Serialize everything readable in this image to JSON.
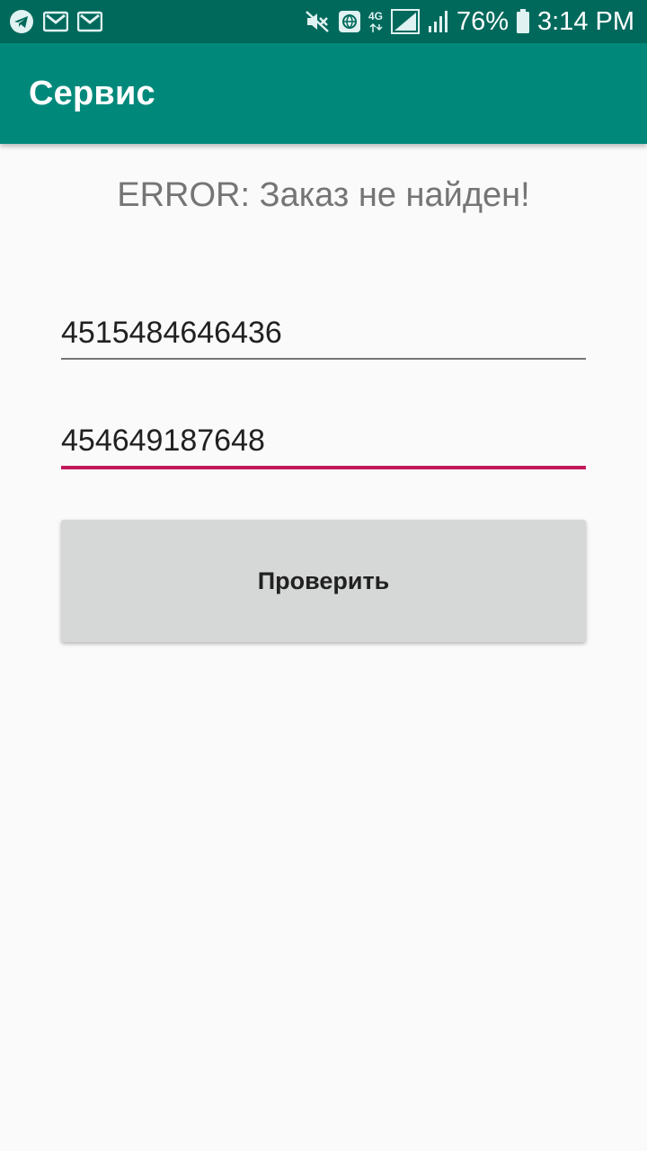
{
  "status_bar": {
    "battery_percent": "76%",
    "time": "3:14 PM",
    "network_type": "4G",
    "icons": [
      "telegram-icon",
      "gmail-icon",
      "gmail-icon",
      "mute-icon",
      "vpn-globe-icon",
      "signal-4g-icon",
      "signal-icon",
      "battery-icon"
    ]
  },
  "app_bar": {
    "title": "Сервис"
  },
  "main": {
    "error_message": "ERROR: Заказ не найден!",
    "field_1_value": "4515484646436",
    "field_2_value": "454649187648",
    "check_button_label": "Проверить"
  },
  "colors": {
    "status_bar": "#00695c",
    "app_bar": "#00897b",
    "accent": "#c2185b",
    "button": "#d6d7d7"
  }
}
